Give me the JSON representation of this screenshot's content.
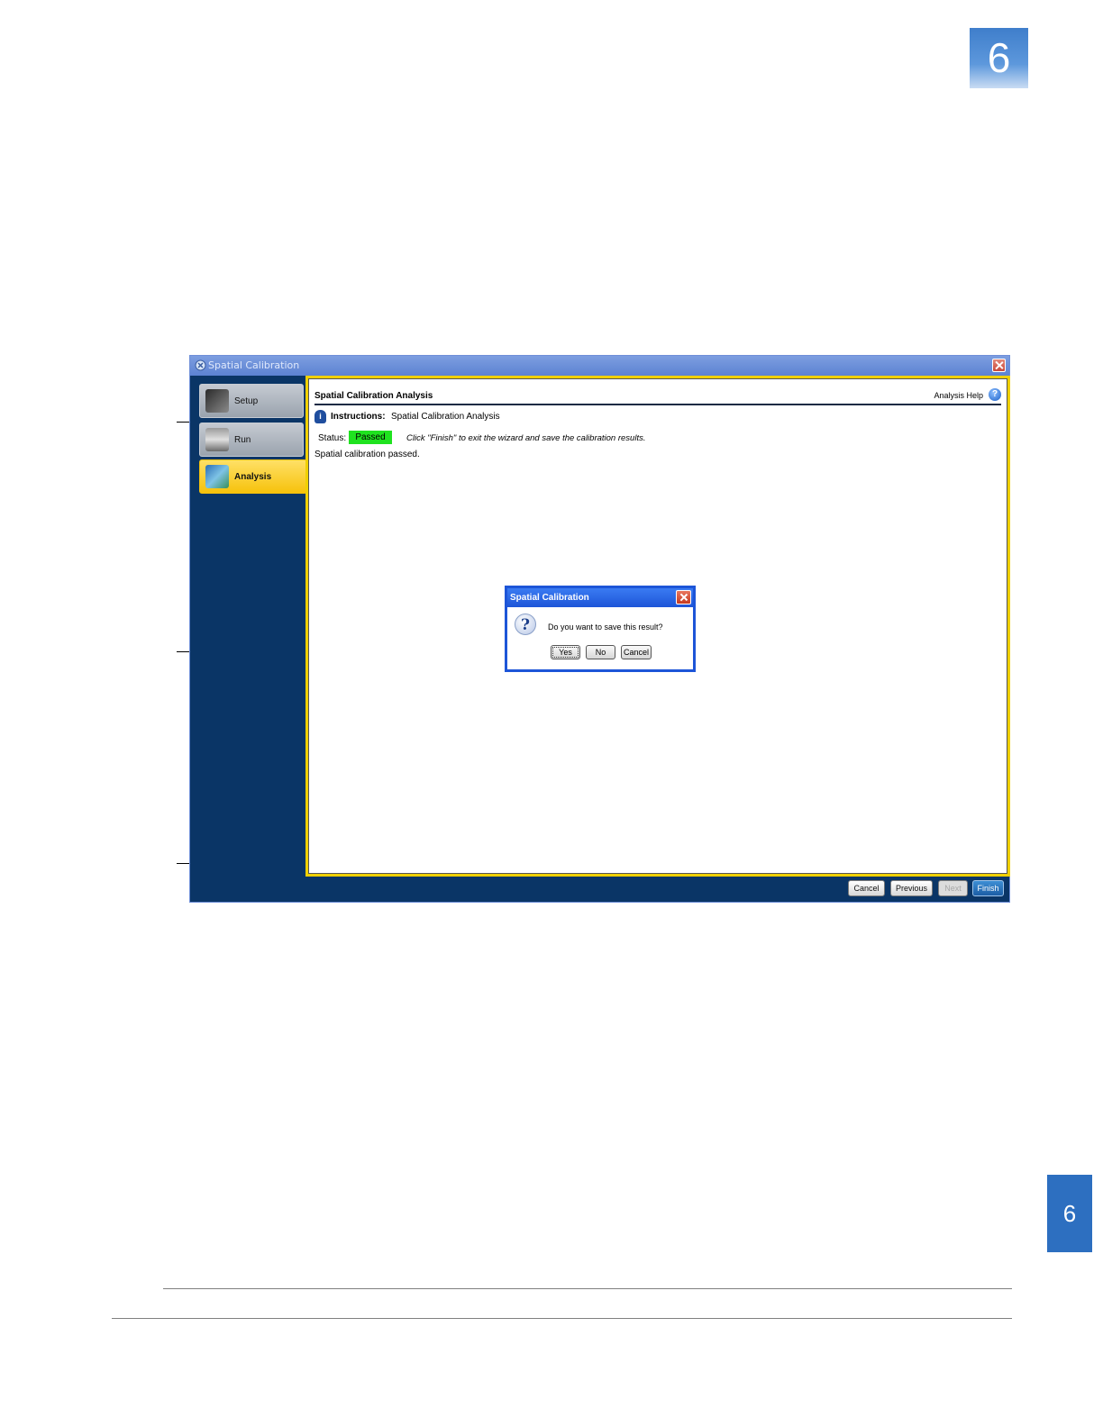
{
  "page": {
    "chapter_badge": "6",
    "side_tab": "6"
  },
  "window": {
    "title": "Spatial Calibration",
    "nav": [
      {
        "label": "Setup",
        "active": false
      },
      {
        "label": "Run",
        "active": false
      },
      {
        "label": "Analysis",
        "active": true
      }
    ],
    "panel": {
      "title": "Spatial Calibration Analysis",
      "help_label": "Analysis Help",
      "instructions_label": "Instructions:",
      "instructions_value": "Spatial Calibration Analysis",
      "status_label": "Status:",
      "status_value": "Passed",
      "status_color": "#1fe21f",
      "hint": "Click \"Finish\" to exit the wizard and save the calibration results.",
      "result": "Spatial calibration passed."
    },
    "footer": {
      "cancel": "Cancel",
      "previous": "Previous",
      "next": "Next",
      "finish": "Finish"
    }
  },
  "dialog": {
    "title": "Spatial Calibration",
    "message": "Do you want to save this result?",
    "yes": "Yes",
    "no": "No",
    "cancel": "Cancel"
  }
}
